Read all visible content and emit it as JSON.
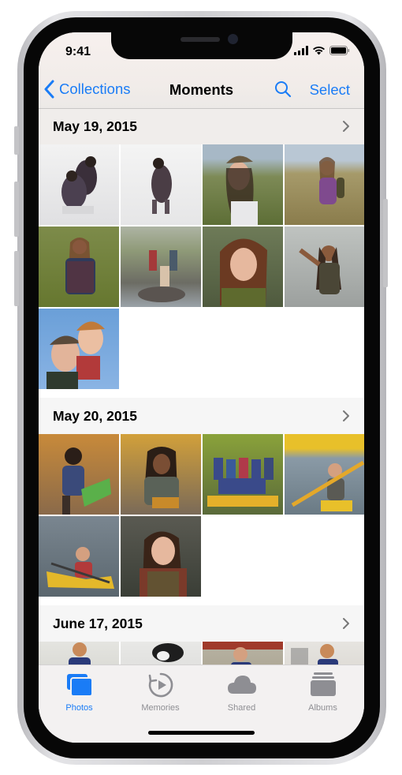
{
  "status": {
    "time": "9:41"
  },
  "nav": {
    "back_label": "Collections",
    "title": "Moments",
    "select_label": "Select"
  },
  "sections": [
    {
      "title": "May 19, 2015",
      "photo_count": 9
    },
    {
      "title": "May 20, 2015",
      "photo_count": 6
    },
    {
      "title": "June 17, 2015",
      "photo_count": 4
    }
  ],
  "tabs": [
    {
      "label": "Photos",
      "icon": "photos-icon",
      "active": true
    },
    {
      "label": "Memories",
      "icon": "memories-icon",
      "active": false
    },
    {
      "label": "Shared",
      "icon": "cloud-icon",
      "active": false
    },
    {
      "label": "Albums",
      "icon": "albums-icon",
      "active": false
    }
  ],
  "colors": {
    "accent": "#1a7cf6",
    "inactive_tab": "#8e8e93"
  }
}
